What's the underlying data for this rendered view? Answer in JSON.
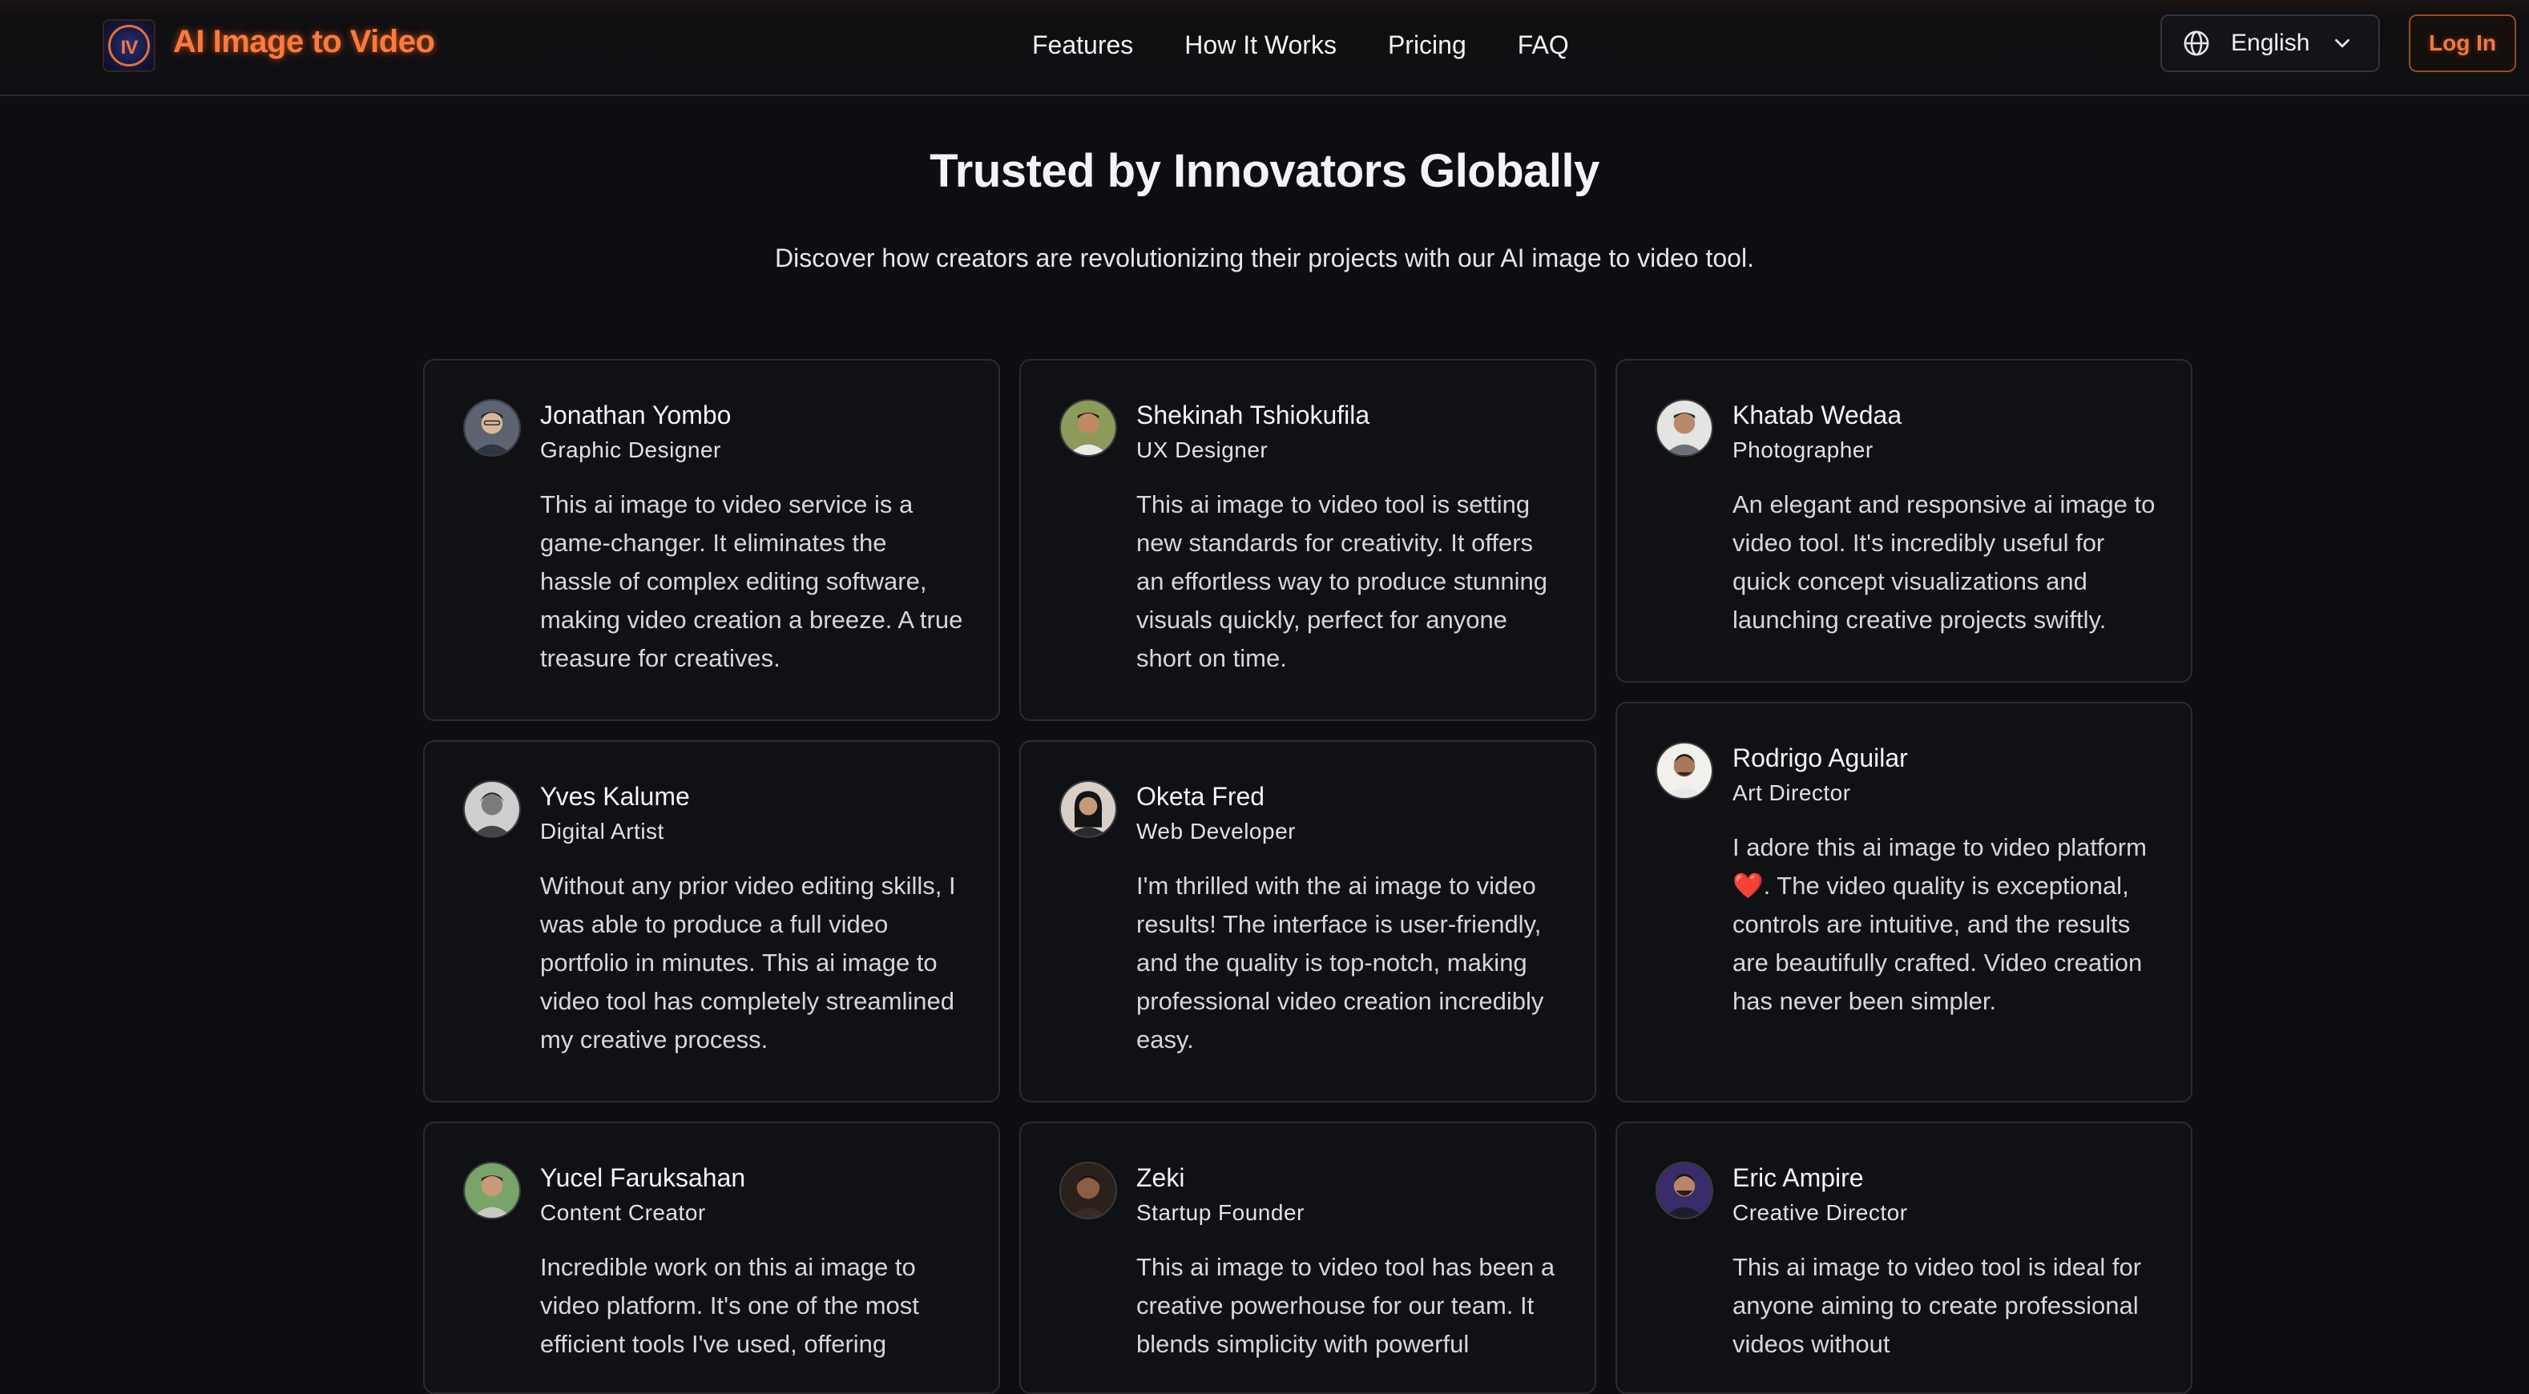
{
  "header": {
    "logo_text": "IV",
    "brand": "AI Image to Video",
    "nav": [
      "Features",
      "How It Works",
      "Pricing",
      "FAQ"
    ],
    "language": "English",
    "login": "Log In"
  },
  "section": {
    "title": "Trusted by Innovators Globally",
    "subtitle": "Discover how creators are revolutionizing their projects with our AI image to video tool."
  },
  "testimonials": [
    {
      "name": "Jonathan Yombo",
      "role": "Graphic Designer",
      "quote": "This ai image to video service is a game-changer. It eliminates the hassle of complex editing software, making video creation a breeze. A true treasure for creatives."
    },
    {
      "name": "Shekinah Tshiokufila",
      "role": "UX Designer",
      "quote": "This ai image to video tool is setting new standards for creativity. It offers an effortless way to produce stunning visuals quickly, perfect for anyone short on time."
    },
    {
      "name": "Khatab Wedaa",
      "role": "Photographer",
      "quote": "An elegant and responsive ai image to video tool. It's incredibly useful for quick concept visualizations and launching creative projects swiftly."
    },
    {
      "name": "Yves Kalume",
      "role": "Digital Artist",
      "quote": "Without any prior video editing skills, I was able to produce a full video portfolio in minutes. This ai image to video tool has completely streamlined my creative process."
    },
    {
      "name": "Oketa Fred",
      "role": "Web Developer",
      "quote": "I'm thrilled with the ai image to video results! The interface is user-friendly, and the quality is top-notch, making professional video creation incredibly easy."
    },
    {
      "name": "Rodrigo Aguilar",
      "role": "Art Director",
      "quote": "I adore this ai image to video platform ❤️. The video quality is exceptional, controls are intuitive, and the results are beautifully crafted. Video creation has never been simpler."
    },
    {
      "name": "Yucel Faruksahan",
      "role": "Content Creator",
      "quote": "Incredible work on this ai image to video platform. It's one of the most efficient tools I've used, offering"
    },
    {
      "name": "Zeki",
      "role": "Startup Founder",
      "quote": "This ai image to video tool has been a creative powerhouse for our team. It blends simplicity with powerful"
    },
    {
      "name": "Eric Ampire",
      "role": "Creative Director",
      "quote": "This ai image to video tool is ideal for anyone aiming to create professional videos without"
    }
  ],
  "colors": {
    "accent": "#ff7a3a",
    "background": "#0d0e11",
    "card_border": "#2b2c31"
  },
  "icons": {
    "language": "globe-icon",
    "dropdown": "chevron-down-icon"
  }
}
